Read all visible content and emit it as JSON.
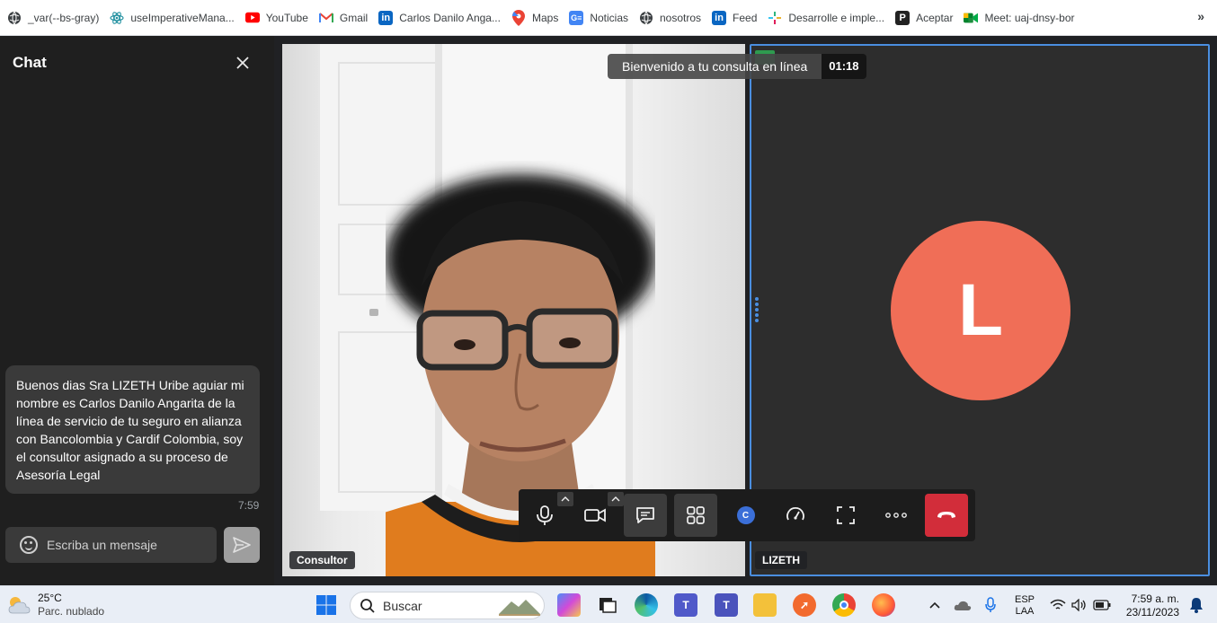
{
  "bookmarks": [
    {
      "label": "_var(--bs-gray)",
      "icon": "globe-icon"
    },
    {
      "label": "useImperativeMana...",
      "icon": "react-icon"
    },
    {
      "label": "YouTube",
      "icon": "youtube-icon"
    },
    {
      "label": "Gmail",
      "icon": "gmail-icon"
    },
    {
      "label": "Carlos Danilo Anga...",
      "icon": "linkedin-icon"
    },
    {
      "label": "Maps",
      "icon": "maps-icon"
    },
    {
      "label": "Noticias",
      "icon": "news-icon"
    },
    {
      "label": "nosotros",
      "icon": "globe-icon"
    },
    {
      "label": "Feed",
      "icon": "linkedin-icon"
    },
    {
      "label": "Desarrolle e imple...",
      "icon": "slack-icon"
    },
    {
      "label": "Aceptar",
      "icon": "p-icon"
    },
    {
      "label": "Meet: uaj-dnsy-bor",
      "icon": "meet-icon"
    }
  ],
  "bookmarks_more": "»",
  "chat": {
    "title": "Chat",
    "message": "Buenos dias Sra LIZETH Uribe aguiar  mi nombre es Carlos Danilo Angarita de la línea de servicio de tu seguro en alianza con Bancolombia y Cardif Colombia, soy el consultor asignado a su proceso de Asesoría Legal",
    "message_time": "7:59",
    "input_placeholder": "Escriba un mensaje"
  },
  "call": {
    "banner_text": "Bienvenido a tu consulta en línea",
    "timer": "01:18",
    "participants": [
      {
        "label": "Consultor"
      },
      {
        "label": "LIZETH",
        "avatar_letter": "L",
        "avatar_color": "#f06e57"
      }
    ],
    "controls": [
      {
        "name": "microphone",
        "icon": "microphone-icon"
      },
      {
        "name": "camera",
        "icon": "camera-icon"
      },
      {
        "name": "chat",
        "icon": "chat-icon",
        "active": true
      },
      {
        "name": "layout",
        "icon": "grid-icon",
        "active": true
      },
      {
        "name": "avatar",
        "icon": "user-badge-icon",
        "badge": "C"
      },
      {
        "name": "speed",
        "icon": "gauge-icon"
      },
      {
        "name": "fullscreen",
        "icon": "fullscreen-icon"
      },
      {
        "name": "more",
        "icon": "more-icon"
      },
      {
        "name": "end-call",
        "icon": "hangup-icon",
        "color": "#d22d3a"
      }
    ]
  },
  "taskbar": {
    "weather_temp": "25°C",
    "weather_cond": "Parc. nublado",
    "search_placeholder": "Buscar",
    "lang_top": "ESP",
    "lang_bottom": "LAA",
    "time": "7:59 a. m.",
    "date": "23/11/2023"
  }
}
